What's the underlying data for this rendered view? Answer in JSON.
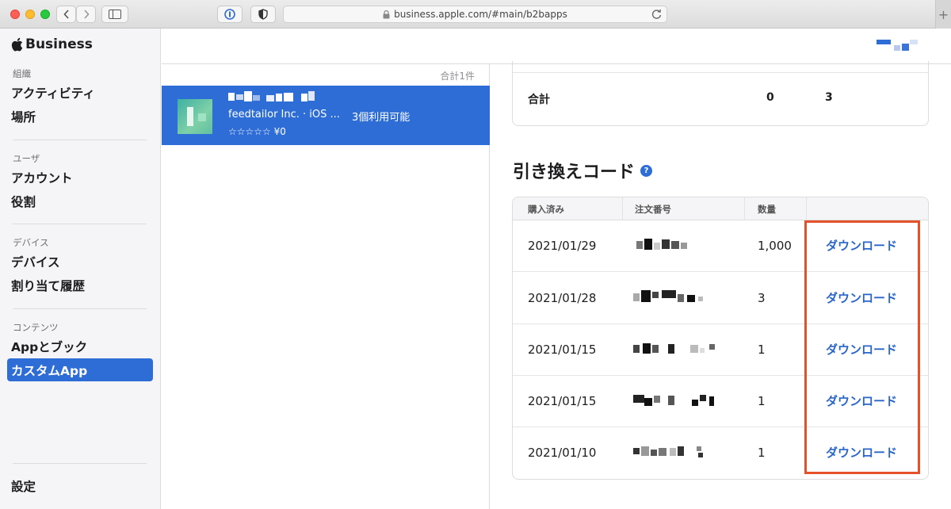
{
  "browser": {
    "url": "business.apple.com/#main/b2bapps"
  },
  "sidebar": {
    "brand": "Business",
    "sections": [
      {
        "title": "組織",
        "items": [
          "アクティビティ",
          "場所"
        ]
      },
      {
        "title": "ユーザ",
        "items": [
          "アカウント",
          "役割"
        ]
      },
      {
        "title": "デバイス",
        "items": [
          "デバイス",
          "割り当て履歴"
        ]
      },
      {
        "title": "コンテンツ",
        "items": [
          "Appとブック",
          "カスタムApp"
        ]
      }
    ],
    "active_item": "カスタムApp",
    "settings": "設定"
  },
  "list": {
    "count": "合計1件",
    "app": {
      "developer": "feedtailor Inc. · iOS ...",
      "availability": "3個利用可能",
      "price": "☆☆☆☆☆ ¥0"
    }
  },
  "summary": {
    "label": "合計",
    "value1": "0",
    "value2": "3"
  },
  "redeem": {
    "title": "引き換えコード",
    "help": "?",
    "headers": [
      "購入済み",
      "注文番号",
      "数量"
    ],
    "rows": [
      {
        "date": "2021/01/29",
        "qty": "1,000",
        "action": "ダウンロード"
      },
      {
        "date": "2021/01/28",
        "qty": "3",
        "action": "ダウンロード"
      },
      {
        "date": "2021/01/15",
        "qty": "1",
        "action": "ダウンロード"
      },
      {
        "date": "2021/01/15",
        "qty": "1",
        "action": "ダウンロード"
      },
      {
        "date": "2021/01/10",
        "qty": "1",
        "action": "ダウンロード"
      }
    ]
  },
  "colors": {
    "accent": "#2e6dd6",
    "link": "#2a66c9",
    "highlight": "#e4512b"
  }
}
